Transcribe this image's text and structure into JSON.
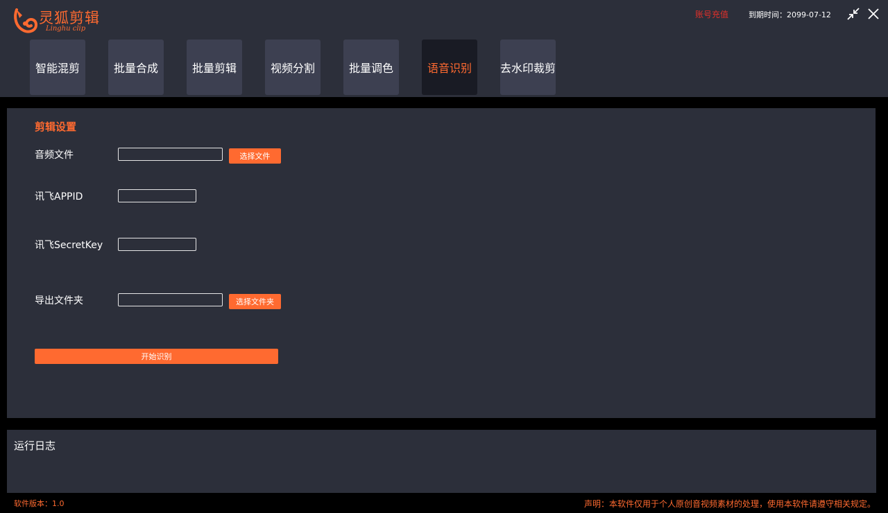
{
  "app": {
    "name": "灵狐剪辑",
    "subtitle": "Linghu clip",
    "icon": "fox-logo-icon",
    "accent_color": "#ff6a30"
  },
  "header": {
    "recharge_label": "账号充值",
    "recharge_color": "#e0302a",
    "expiry_text": "到期时间：2099-07-12",
    "minimize_icon": "collapse-arrows-icon",
    "close_icon": "close-icon"
  },
  "tabs": [
    {
      "label": "智能混剪",
      "active": false
    },
    {
      "label": "批量合成",
      "active": false
    },
    {
      "label": "批量剪辑",
      "active": false
    },
    {
      "label": "视频分割",
      "active": false
    },
    {
      "label": "批量调色",
      "active": false
    },
    {
      "label": "语音识别",
      "active": true
    },
    {
      "label": "去水印裁剪",
      "active": false
    }
  ],
  "settings": {
    "title": "剪辑设置",
    "audio_file": {
      "label": "音频文件",
      "value": "",
      "button": "选择文件"
    },
    "appid": {
      "label": "讯飞APPID",
      "value": ""
    },
    "secret_key": {
      "label": "讯飞SecretKey",
      "value": ""
    },
    "export_folder": {
      "label": "导出文件夹",
      "value": "",
      "button": "选择文件夹"
    },
    "start_button": "开始识别"
  },
  "log": {
    "title": "运行日志"
  },
  "footer": {
    "version": "软件版本：1.0",
    "disclaimer": "声明：本软件仅用于个人原创音视频素材的处理，使用本软件请遵守相关规定。"
  }
}
